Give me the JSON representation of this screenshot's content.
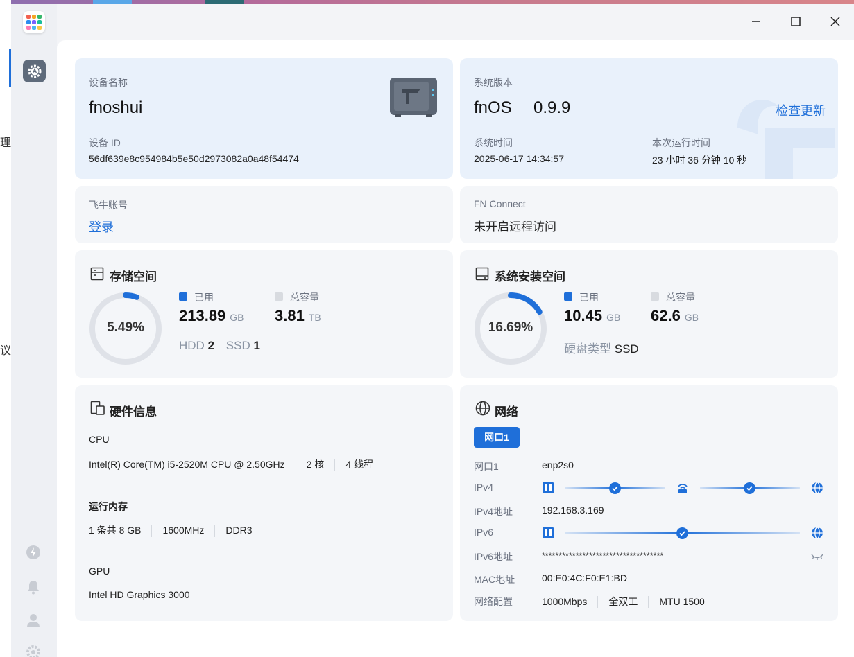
{
  "left_fragments": [
    "理",
    "议"
  ],
  "device": {
    "name_label": "设备名称",
    "name": "fnoshui",
    "id_label": "设备 ID",
    "id": "56df639e8c954984b5e50d2973082a0a48f54474"
  },
  "system": {
    "version_label": "系统版本",
    "os": "fnOS",
    "version": "0.9.9",
    "check_update": "检查更新",
    "time_label": "系统时间",
    "time": "2025-06-17 14:34:57",
    "uptime_label": "本次运行时间",
    "uptime": "23 小时 36 分钟 10 秒"
  },
  "account": {
    "label": "飞牛账号",
    "login": "登录"
  },
  "fnconnect": {
    "label": "FN Connect",
    "status": "未开启远程访问"
  },
  "storage": {
    "title": "存储空间",
    "percent": "5.49%",
    "fraction": 0.0549,
    "used_label": "已用",
    "used": "213.89",
    "used_unit": "GB",
    "total_label": "总容量",
    "total": "3.81",
    "total_unit": "TB",
    "hdd_label": "HDD",
    "hdd": "2",
    "ssd_label": "SSD",
    "ssd": "1"
  },
  "sysdisk": {
    "title": "系统安装空间",
    "percent": "16.69%",
    "fraction": 0.1669,
    "used_label": "已用",
    "used": "10.45",
    "used_unit": "GB",
    "total_label": "总容量",
    "total": "62.6",
    "total_unit": "GB",
    "disk_type_label": "硬盘类型",
    "disk_type": "SSD"
  },
  "hardware": {
    "title": "硬件信息",
    "cpu_label": "CPU",
    "cpu_model": "Intel(R) Core(TM) i5-2520M CPU @ 2.50GHz",
    "cpu_cores": "2 核",
    "cpu_threads": "4 线程",
    "mem_label": "运行内存",
    "mem_size": "1 条共 8 GB",
    "mem_freq": "1600MHz",
    "mem_type": "DDR3",
    "gpu_label": "GPU",
    "gpu": "Intel HD Graphics 3000"
  },
  "network": {
    "title": "网络",
    "tab": "网口1",
    "port_label": "网口1",
    "port": "enp2s0",
    "ipv4_label": "IPv4",
    "ipv4_addr_label": "IPv4地址",
    "ipv4_addr": "192.168.3.169",
    "ipv6_label": "IPv6",
    "ipv6_addr_label": "IPv6地址",
    "ipv6_addr": "************************************",
    "mac_label": "MAC地址",
    "mac": "00:E0:4C:F0:E1:BD",
    "config_label": "网络配置",
    "speed": "1000Mbps",
    "duplex": "全双工",
    "mtu": "MTU 1500"
  },
  "colors": {
    "accent": "#1f6fd9",
    "ring_track": "#dfe2e8",
    "legend_total": "#d8dbe0"
  },
  "icons": [
    "app-launcher-icon",
    "settings-icon",
    "storage-icon",
    "disk-icon",
    "hardware-icon",
    "globe-icon",
    "nas-device-icon",
    "minimize-icon",
    "maximize-icon",
    "close-icon",
    "ethernet-port-icon",
    "router-icon",
    "check-icon",
    "eye-hidden-icon",
    "speed-icon",
    "bell-icon",
    "user-icon",
    "gear-icon"
  ]
}
